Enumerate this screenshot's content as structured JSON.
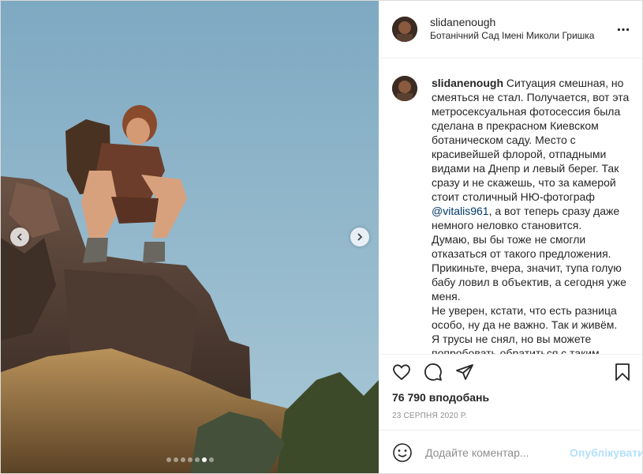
{
  "post": {
    "username": "slidanenough",
    "location": "Ботанічний Сад Імені Миколи Гришка",
    "caption_user": "slidanenough",
    "caption_part1": " Ситуация смешная, но смеяться не стал. Получается, вот эта метросексуальная фотосессия была сделана в прекрасном Киевском ботаническом саду. Место с красивейшей флорой, отпадными видами на Днепр и левый берег. Так сразу и не скажешь, что за камерой стоит столичный НЮ-фотограф ",
    "mention": "@vitalis961",
    "caption_part2": ", а вот теперь сразу даже немного неловко становится.\nДумаю, вы бы тоже не смогли отказаться от такого предложения. Прикиньте, вчера, значит, тупа голую бабу ловил в объектив, а сегодня уже меня.\nНе уверен, кстати, что есть разница особо, ну да не важно. Так и живём.\nЯ трусы не снял, но вы можете попробовать обратиться с таким предложением",
    "likes": "76 790 вподобань",
    "date": "23 серпня 2020 р.",
    "comment_placeholder": "Додайте коментар...",
    "publish_label": "Опублікувати"
  },
  "carousel": {
    "slide_count": 7,
    "active_index": 5
  },
  "icons": {
    "more": "more-options-icon",
    "like": "heart-icon",
    "comment": "comment-bubble-icon",
    "share": "paper-plane-icon",
    "save": "bookmark-icon",
    "emoji": "emoji-icon",
    "prev": "chevron-left-icon",
    "next": "chevron-right-icon"
  },
  "colors": {
    "text": "#262626",
    "secondary": "#8e8e8e",
    "mention": "#00376b",
    "publish_disabled": "#b2dffc",
    "border": "#dbdbdb"
  }
}
